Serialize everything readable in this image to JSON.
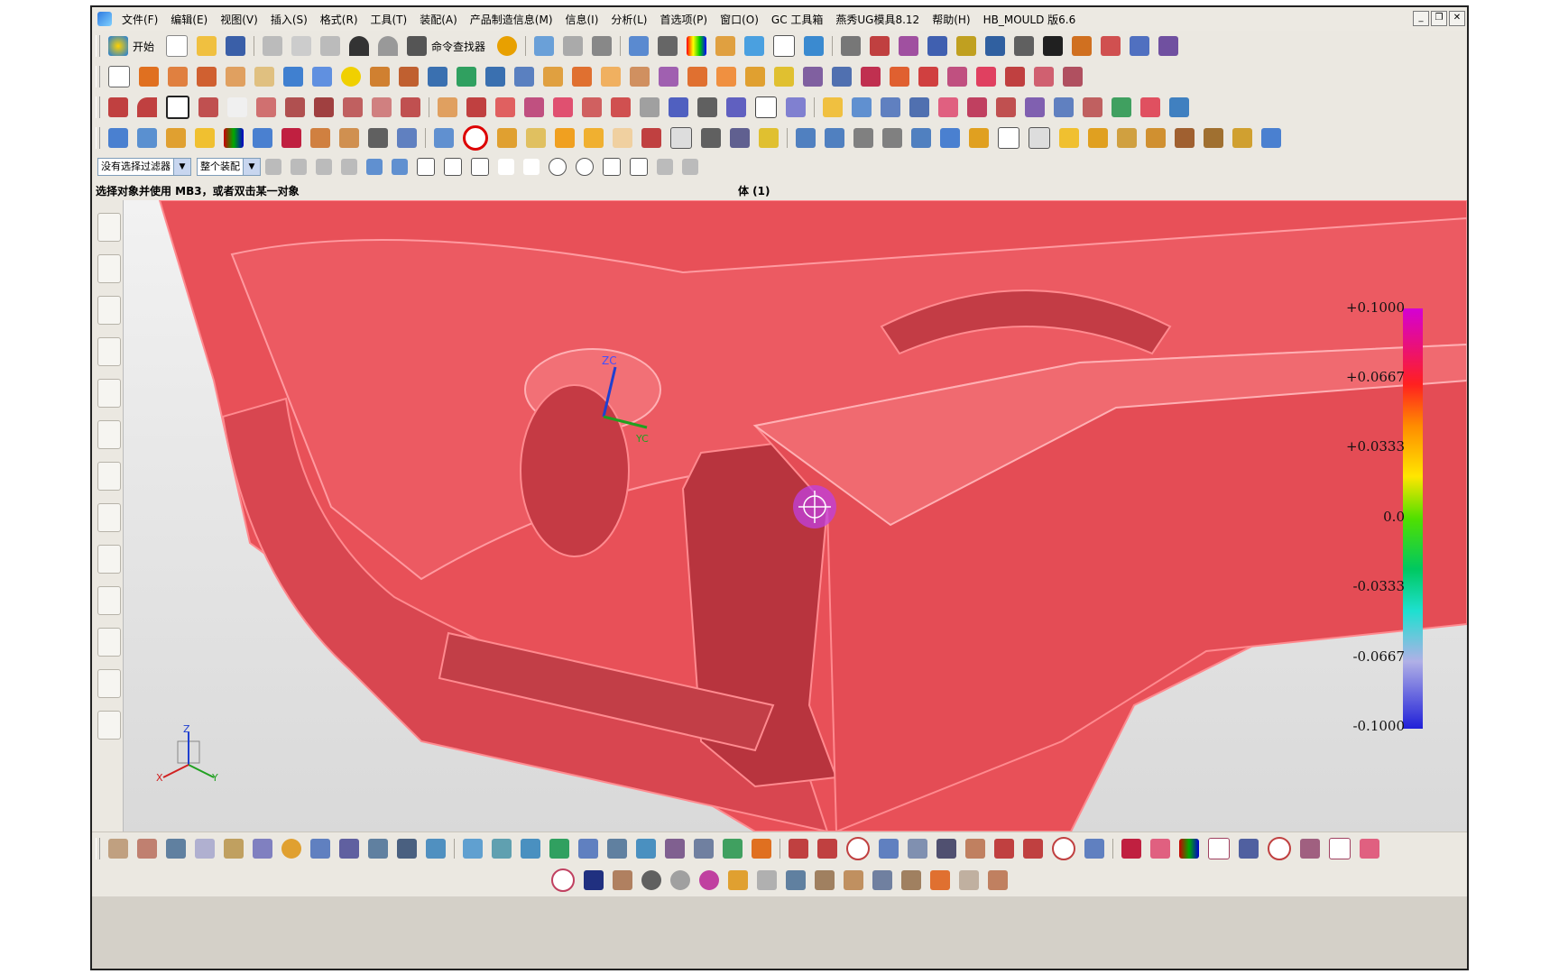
{
  "menu": [
    "文件(F)",
    "编辑(E)",
    "视图(V)",
    "插入(S)",
    "格式(R)",
    "工具(T)",
    "装配(A)",
    "产品制造信息(M)",
    "信息(I)",
    "分析(L)",
    "首选项(P)",
    "窗口(O)",
    "GC 工具箱",
    "燕秀UG模具8.12",
    "帮助(H)",
    "HB_MOULD 版6.6"
  ],
  "toolbar": {
    "start_label": "开始",
    "command_finder": "命令查找器"
  },
  "selection": {
    "filter": "没有选择过滤器",
    "scope": "整个装配"
  },
  "status": {
    "prompt": "选择对象并使用 MB3，或者双击某一对象",
    "selected": "体 (1)"
  },
  "window_controls": [
    "_",
    "❐",
    "✕"
  ],
  "colors": {
    "part": "#e85058",
    "part_dark": "#b8343e",
    "edge": "#ff8a8f"
  },
  "scale_labels": [
    "+0.1000",
    "+0.0667",
    "+0.0333",
    "0.0",
    "-0.0333",
    "-0.0667",
    "-0.1000"
  ],
  "axes": {
    "zc": "ZC",
    "yc": "YC",
    "z": "Z",
    "y": "Y",
    "x": "X"
  }
}
